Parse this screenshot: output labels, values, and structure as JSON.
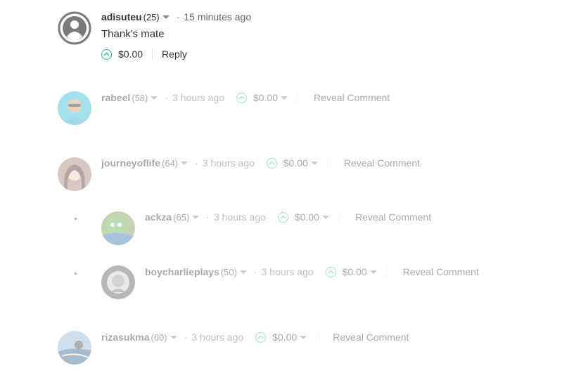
{
  "top_comment": {
    "author": "adisuteu",
    "reputation": "(25)",
    "time": "15 minutes ago",
    "body": "Thank's mate",
    "payout": "$0.00",
    "reply_label": "Reply"
  },
  "collapsed_comments": [
    {
      "author": "rabeel",
      "reputation": "(58)",
      "time": "3 hours ago",
      "payout": "$0.00",
      "reveal_label": "Reveal Comment"
    },
    {
      "author": "journeyoflife",
      "reputation": "(64)",
      "time": "3 hours ago",
      "payout": "$0.00",
      "reveal_label": "Reveal Comment"
    },
    {
      "author": "ackza",
      "reputation": "(65)",
      "time": "3 hours ago",
      "payout": "$0.00",
      "reveal_label": "Reveal Comment"
    },
    {
      "author": "boycharlieplays",
      "reputation": "(50)",
      "time": "3 hours ago",
      "payout": "$0.00",
      "reveal_label": "Reveal Comment"
    },
    {
      "author": "rizasukma",
      "reputation": "(60)",
      "time": "3 hours ago",
      "payout": "$0.00",
      "reveal_label": "Reveal Comment"
    }
  ],
  "colors": {
    "upvote": "#1fbf8f",
    "text": "#333333",
    "muted": "#666666"
  },
  "icons": {
    "upvote": "chevron-up-circle-icon",
    "dropdown": "caret-down-icon",
    "avatar_placeholder": "user-icon"
  }
}
